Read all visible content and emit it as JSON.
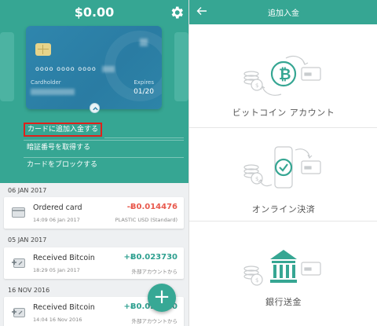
{
  "left": {
    "balance": "$0.00",
    "card": {
      "number_mask": "oooo  oooo  oooo",
      "cardholder_label": "Cardholder",
      "expires_label": "Expires",
      "expiry": "01/20"
    },
    "menu": {
      "add_funds": "カードに追加入金する",
      "get_pin": "暗証番号を取得する",
      "block_card": "カードをブロックする"
    },
    "transactions": [
      {
        "date": "06 JAN 2017",
        "title": "Ordered card",
        "time": "14:09 06 Jan 2017",
        "amount": "-Ƀ0.014476",
        "sub": "PLASTIC USD (Standard)",
        "icon": "card-icon",
        "direction": "out"
      },
      {
        "date": "05 JAN 2017",
        "title": "Received Bitcoin",
        "time": "18:29 05 Jan 2017",
        "amount": "+Ƀ0.023730",
        "sub": "外部アカウントから",
        "icon": "receive-icon",
        "direction": "in"
      },
      {
        "date": "16 NOV 2016",
        "title": "Received Bitcoin",
        "time": "14:04 16 Nov 2016",
        "amount": "+Ƀ0.024820",
        "sub": "外部アカウントから",
        "icon": "receive-icon",
        "direction": "in"
      }
    ],
    "fab_label": "+"
  },
  "right": {
    "title": "追加入金",
    "methods": [
      {
        "label": "ビットコイン アカウント",
        "icon": "bitcoin-icon"
      },
      {
        "label": "オンライン決済",
        "icon": "phone-check-icon"
      },
      {
        "label": "銀行送金",
        "icon": "bank-icon"
      }
    ]
  },
  "colors": {
    "brand_teal": "#36a693",
    "negative": "#e8594d",
    "positive": "#2fa090",
    "highlight": "#e0211b"
  }
}
